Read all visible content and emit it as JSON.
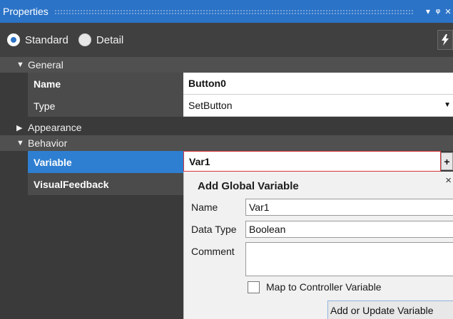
{
  "panel": {
    "title": "Properties",
    "pin_glyph": "▾",
    "dock_glyph": "ꟸ",
    "close_glyph": "×"
  },
  "modes": {
    "standard_label": "Standard",
    "detail_label": "Detail",
    "selected": "Standard",
    "events_icon": "lightning-icon"
  },
  "sections": {
    "general": "General",
    "appearance": "Appearance",
    "behavior": "Behavior"
  },
  "properties": {
    "name_label": "Name",
    "name_value": "Button0",
    "type_label": "Type",
    "type_value": "SetButton",
    "variable_label": "Variable",
    "variable_value": "Var1",
    "visualfeedback_label": "VisualFeedback"
  },
  "popup": {
    "title": "Add Global Variable",
    "close": "×",
    "name_label": "Name",
    "name_value": "Var1",
    "datatype_label": "Data Type",
    "datatype_value": "Boolean",
    "comment_label": "Comment",
    "comment_value": "",
    "map_label": "Map to Controller Variable",
    "map_checked": false,
    "add_button": "Add or Update Variable"
  },
  "colors": {
    "accent": "#2b73c7",
    "selected_row": "#2e7fd1",
    "panel_bg": "#3a3a3a",
    "error_border": "#d8343c"
  }
}
